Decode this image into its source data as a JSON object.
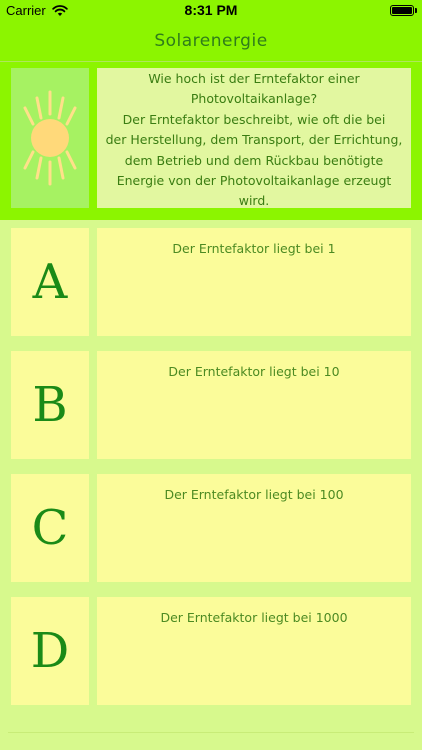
{
  "status": {
    "carrier": "Carrier",
    "time": "8:31 PM",
    "battery_percent": 100
  },
  "nav": {
    "title": "Solarenergie"
  },
  "question": {
    "text": "Wie hoch ist der Erntefaktor einer\nPhotovoltaikanlage?\nDer Erntefaktor beschreibt, wie oft die bei\nder Herstellung, dem Transport, der Errichtung,\ndem Betrieb und dem Rückbau benötigte\nEnergie von der Photovoltaikanlage erzeugt\nwird.",
    "icon": "sun-icon"
  },
  "answers": [
    {
      "letter": "A",
      "text": "Der Erntefaktor liegt bei 1"
    },
    {
      "letter": "B",
      "text": "Der Erntefaktor liegt bei 10"
    },
    {
      "letter": "C",
      "text": "Der Erntefaktor liegt bei 100"
    },
    {
      "letter": "D",
      "text": "Der Erntefaktor liegt bei 1000"
    }
  ],
  "colors": {
    "header": "#8cf500",
    "background": "#d7f98d",
    "card": "#fbfc9a",
    "text": "#1a8a17",
    "sun": "#ffd97a"
  }
}
